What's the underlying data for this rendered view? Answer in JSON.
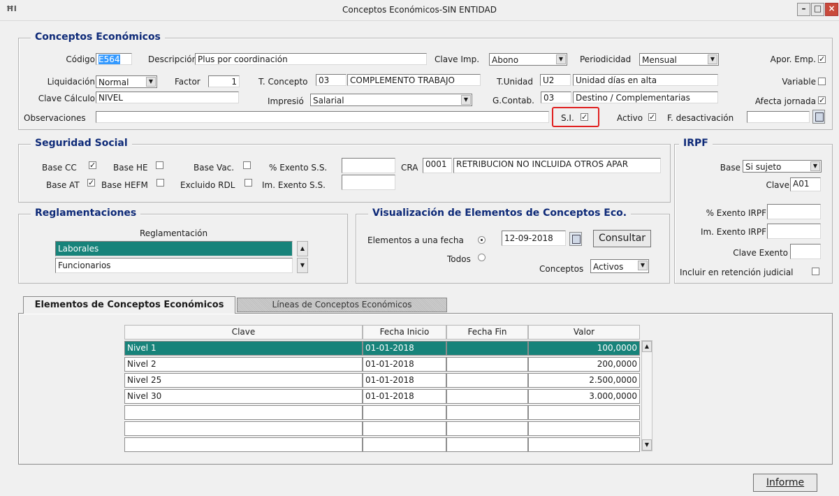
{
  "window": {
    "title": "Conceptos Económicos-SIN ENTIDAD",
    "min": "–",
    "max": "□",
    "close": "×"
  },
  "conceptos": {
    "group_title": "Conceptos Económicos",
    "codigo_label": "Código",
    "codigo_value": "E564",
    "descripcion_label": "Descripción",
    "descripcion_value": "Plus por coordinación",
    "clave_imp_label": "Clave Imp.",
    "clave_imp_value": "Abono",
    "periodicidad_label": "Periodicidad",
    "periodicidad_value": "Mensual",
    "apor_emp_label": "Apor. Emp.",
    "liquidacion_label": "Liquidación",
    "liquidacion_value": "Normal",
    "factor_label": "Factor",
    "factor_value": "1",
    "t_concepto_label": "T. Concepto",
    "t_concepto_code": "03",
    "t_concepto_desc": "COMPLEMENTO TRABAJO",
    "t_unidad_label": "T.Unidad",
    "t_unidad_code": "U2",
    "t_unidad_desc": "Unidad días en alta",
    "variable_label": "Variable",
    "clave_calculo_label": "Clave Cálculo",
    "clave_calculo_value": "NIVEL",
    "impresio_label": "Impresió",
    "impresio_value": "Salarial",
    "g_contab_label": "G.Contab.",
    "g_contab_code": "03",
    "g_contab_desc": "Destino / Complementarias",
    "afecta_jornada_label": "Afecta jornada",
    "observaciones_label": "Observaciones",
    "observaciones_value": "",
    "si_label": "S.I.",
    "activo_label": "Activo",
    "f_desactivacion_label": "F. desactivación",
    "f_desactivacion_value": ""
  },
  "seguridad": {
    "group_title": "Seguridad Social",
    "base_cc": "Base CC",
    "base_he": "Base HE",
    "base_vac": "Base Vac.",
    "pct_exento": "% Exento S.S.",
    "cra_label": "CRA",
    "cra_code": "0001",
    "cra_desc": "RETRIBUCION NO INCLUIDA OTROS APAR",
    "base_at": "Base AT",
    "base_hefm": "Base HEFM",
    "excluido_rdl": "Excluido RDL",
    "im_exento": "Im. Exento S.S."
  },
  "irpf": {
    "group_title": "IRPF",
    "base_label": "Base",
    "base_value": "Si sujeto",
    "clave_label": "Clave",
    "clave_value": "A01",
    "pct_exento": "% Exento IRPF",
    "im_exento": "Im. Exento IRPF",
    "clave_exento": "Clave Exento",
    "incluir": "Incluir en retención judicial"
  },
  "reglamentaciones": {
    "group_title": "Reglamentaciones",
    "column": "Reglamentación",
    "items": [
      "Laborales",
      "Funcionarios"
    ]
  },
  "visualizacion": {
    "group_title": "Visualización de Elementos de Conceptos Eco.",
    "elementos_label": "Elementos a una fecha",
    "fecha_value": "12-09-2018",
    "consultar": "Consultar",
    "todos_label": "Todos",
    "conceptos_label": "Conceptos",
    "conceptos_value": "Activos"
  },
  "tabs": [
    "Elementos de Conceptos Económicos",
    "Líneas de Conceptos Económicos"
  ],
  "table": {
    "headers": [
      "Clave",
      "Fecha Inicio",
      "Fecha Fin",
      "Valor"
    ],
    "rows": [
      [
        "Nivel 1",
        "01-01-2018",
        "",
        "100,0000"
      ],
      [
        "Nivel 2",
        "01-01-2018",
        "",
        "200,0000"
      ],
      [
        "Nivel 25",
        "01-01-2018",
        "",
        "2.500,0000"
      ],
      [
        "Nivel 30",
        "01-01-2018",
        "",
        "3.000,0000"
      ],
      [
        "",
        "",
        "",
        ""
      ],
      [
        "",
        "",
        "",
        ""
      ],
      [
        "",
        "",
        "",
        ""
      ]
    ]
  },
  "informe_button": "Informe",
  "icons": {
    "check": "✓",
    "up": "▲",
    "down": "▼"
  }
}
